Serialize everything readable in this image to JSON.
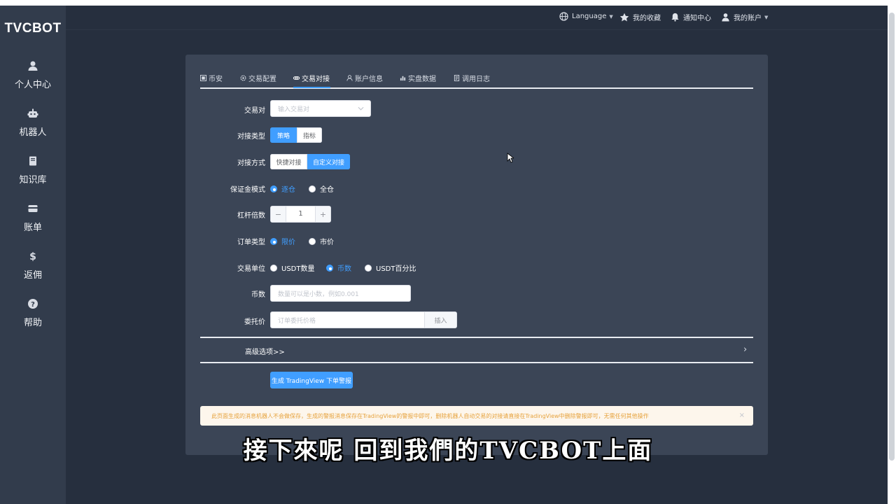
{
  "brand": "TVCBOT",
  "sidebar": {
    "items": [
      {
        "label": "个人中心",
        "icon": "user-icon"
      },
      {
        "label": "机器人",
        "icon": "robot-icon"
      },
      {
        "label": "知识库",
        "icon": "book-icon"
      },
      {
        "label": "账单",
        "icon": "bill-icon"
      },
      {
        "label": "返佣",
        "icon": "dollar-icon"
      },
      {
        "label": "帮助",
        "icon": "help-icon"
      }
    ]
  },
  "topbar": {
    "language": "Language",
    "favorites": "我的收藏",
    "notifications": "通知中心",
    "account": "我的账户"
  },
  "tabs": [
    {
      "label": "币安",
      "icon": "exchange-icon"
    },
    {
      "label": "交易配置",
      "icon": "gear-icon"
    },
    {
      "label": "交易对接",
      "icon": "link-icon",
      "active": true
    },
    {
      "label": "账户信息",
      "icon": "user-icon"
    },
    {
      "label": "实盘数据",
      "icon": "chart-icon"
    },
    {
      "label": "调用日志",
      "icon": "log-icon"
    }
  ],
  "form": {
    "pair": {
      "label": "交易对",
      "placeholder": "输入交易对"
    },
    "dock_type": {
      "label": "对接类型",
      "options": [
        "策略",
        "指标"
      ],
      "selected": "策略"
    },
    "dock_method": {
      "label": "对接方式",
      "options": [
        "快捷对接",
        "自定义对接"
      ],
      "selected": "自定义对接"
    },
    "margin_mode": {
      "label": "保证金模式",
      "options": [
        "逐仓",
        "全仓"
      ],
      "selected": "逐仓"
    },
    "leverage": {
      "label": "杠杆倍数",
      "value": "1",
      "minus": "−",
      "plus": "+"
    },
    "order_type": {
      "label": "订单类型",
      "options": [
        "限价",
        "市价"
      ],
      "selected": "限价"
    },
    "trade_unit": {
      "label": "交易单位",
      "options": [
        "USDT数量",
        "币数",
        "USDT百分比"
      ],
      "selected": "币数"
    },
    "coin_amount": {
      "label": "币数",
      "placeholder": "数量可以是小数，例如0.001"
    },
    "entrust_price": {
      "label": "委托价",
      "placeholder": "订单委托价格",
      "append": "插入"
    }
  },
  "advanced": {
    "label": "高级选项>>",
    "arrow": "›"
  },
  "generate_button": "生成 TradingView 下单警报",
  "alert": {
    "text": "此页面生成的消息机器人不会做保存，生成的警报消息保存在TradingView的警报中即可，删除机器人自动交易的对接请直接在TradingView中删除警报即可，无需任何其他操作",
    "close": "×"
  },
  "subtitle": "接下來呢 回到我們的TVCBOT上面",
  "colors": {
    "primary": "#409eff",
    "sidebar_bg": "#323c4c",
    "page_bg": "#262f3e",
    "card_bg": "#3b4556",
    "warning_bg": "#fdf6ec",
    "warning_text": "#e6a23c"
  }
}
